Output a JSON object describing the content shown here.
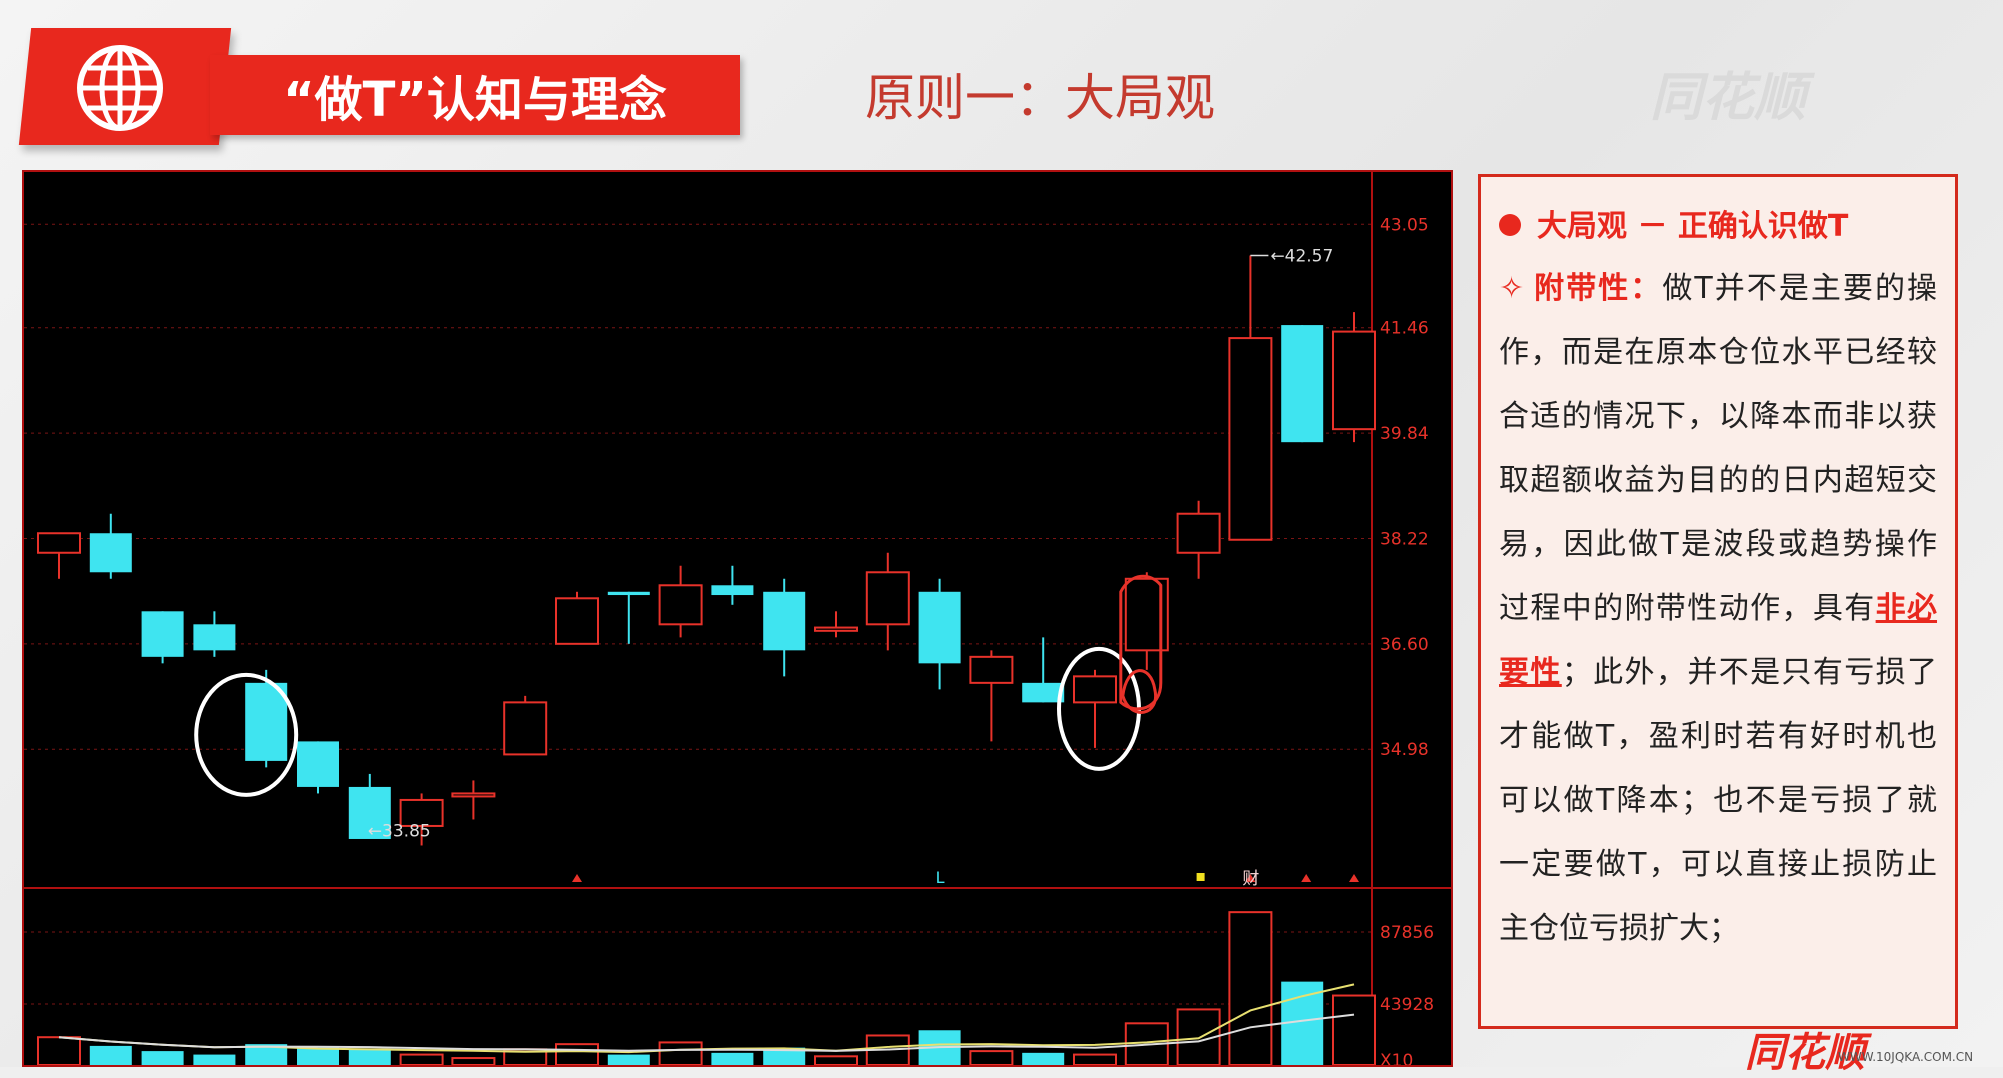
{
  "header": {
    "title": "“做T”认知与理念",
    "principle": "原则一：大局观",
    "watermark": "同花顺",
    "watermark_bottom": "同花顺",
    "watermark_url": "WWW.10JQKA.COM.CN"
  },
  "panel": {
    "heading": "大局观 － 正确认识做T",
    "attr_label": "附带性：",
    "para_1": "做T并不是主要的操作，而是在原本仓位水平已经较合适的情况下，以降本而非以获取超额收益为目的的日内超短交易，因此做T是波段或趋势操作过程中的附带性动作，具有",
    "emphasis": "非必要性",
    "para_2": "；此外，并不是只有亏损了才能做T，盈利时若有好时机也可以做T降本；也不是亏损了就一定要做T，可以直接止损防止主仓位亏损扩大；",
    "colors": {
      "accent": "#e8281e",
      "panel_bg": "#fbeee9"
    }
  },
  "chart_data": {
    "type": "candlestick",
    "price_ylim": [
      33.0,
      43.3
    ],
    "price_ticks": [
      "43.05",
      "41.46",
      "39.84",
      "38.22",
      "36.60",
      "34.98"
    ],
    "volume_ticks": [
      "87856",
      "43928",
      "X10"
    ],
    "annotations": {
      "high_label": "42.57",
      "low_label": "33.85",
      "markers": [
        "L",
        "财"
      ]
    },
    "candles": [
      {
        "o": 38.0,
        "h": 38.3,
        "l": 37.6,
        "c": 38.3,
        "up": true,
        "v": 16000
      },
      {
        "o": 38.3,
        "h": 38.6,
        "l": 37.6,
        "c": 37.7,
        "up": false,
        "v": 11000
      },
      {
        "o": 37.1,
        "h": 37.1,
        "l": 36.3,
        "c": 36.4,
        "up": false,
        "v": 8000
      },
      {
        "o": 36.9,
        "h": 37.1,
        "l": 36.4,
        "c": 36.5,
        "up": false,
        "v": 6000
      },
      {
        "o": 36.0,
        "h": 36.2,
        "l": 34.7,
        "c": 34.8,
        "up": false,
        "v": 12000
      },
      {
        "o": 35.1,
        "h": 35.1,
        "l": 34.3,
        "c": 34.4,
        "up": false,
        "v": 10000
      },
      {
        "o": 34.4,
        "h": 34.6,
        "l": 33.85,
        "c": 33.6,
        "up": false,
        "v": 9000
      },
      {
        "o": 33.8,
        "h": 34.3,
        "l": 33.5,
        "c": 34.2,
        "up": true,
        "v": 6000
      },
      {
        "o": 34.3,
        "h": 34.5,
        "l": 33.9,
        "c": 34.3,
        "up": true,
        "v": 4000
      },
      {
        "o": 34.9,
        "h": 35.8,
        "l": 34.9,
        "c": 35.7,
        "up": true,
        "v": 9000
      },
      {
        "o": 36.6,
        "h": 37.4,
        "l": 36.6,
        "c": 37.3,
        "up": true,
        "v": 12000
      },
      {
        "o": 37.4,
        "h": 37.4,
        "l": 36.6,
        "c": 37.35,
        "up": false,
        "v": 6000
      },
      {
        "o": 36.9,
        "h": 37.8,
        "l": 36.7,
        "c": 37.5,
        "up": true,
        "v": 13000
      },
      {
        "o": 37.5,
        "h": 37.8,
        "l": 37.2,
        "c": 37.35,
        "up": false,
        "v": 7000
      },
      {
        "o": 37.4,
        "h": 37.6,
        "l": 36.1,
        "c": 36.5,
        "up": false,
        "v": 10000
      },
      {
        "o": 36.8,
        "h": 37.1,
        "l": 36.7,
        "c": 36.85,
        "up": true,
        "v": 5000
      },
      {
        "o": 36.9,
        "h": 38.0,
        "l": 36.5,
        "c": 37.7,
        "up": true,
        "v": 17000
      },
      {
        "o": 37.4,
        "h": 37.6,
        "l": 35.9,
        "c": 36.3,
        "up": false,
        "v": 20000
      },
      {
        "o": 36.0,
        "h": 36.5,
        "l": 35.1,
        "c": 36.4,
        "up": true,
        "v": 8000
      },
      {
        "o": 36.0,
        "h": 36.7,
        "l": 35.7,
        "c": 35.7,
        "up": false,
        "v": 7000
      },
      {
        "o": 35.7,
        "h": 36.2,
        "l": 35.0,
        "c": 36.1,
        "up": true,
        "v": 6000
      },
      {
        "o": 36.5,
        "h": 37.7,
        "l": 36.2,
        "c": 37.6,
        "up": true,
        "v": 24000
      },
      {
        "o": 38.0,
        "h": 38.8,
        "l": 37.6,
        "c": 38.6,
        "up": true,
        "v": 32000
      },
      {
        "o": 38.2,
        "h": 42.57,
        "l": 38.2,
        "c": 41.3,
        "up": true,
        "v": 88000
      },
      {
        "o": 41.5,
        "h": 41.5,
        "l": 39.7,
        "c": 39.7,
        "up": false,
        "v": 48000
      },
      {
        "o": 39.9,
        "h": 41.7,
        "l": 39.7,
        "c": 41.4,
        "up": true,
        "v": 40000
      }
    ]
  }
}
